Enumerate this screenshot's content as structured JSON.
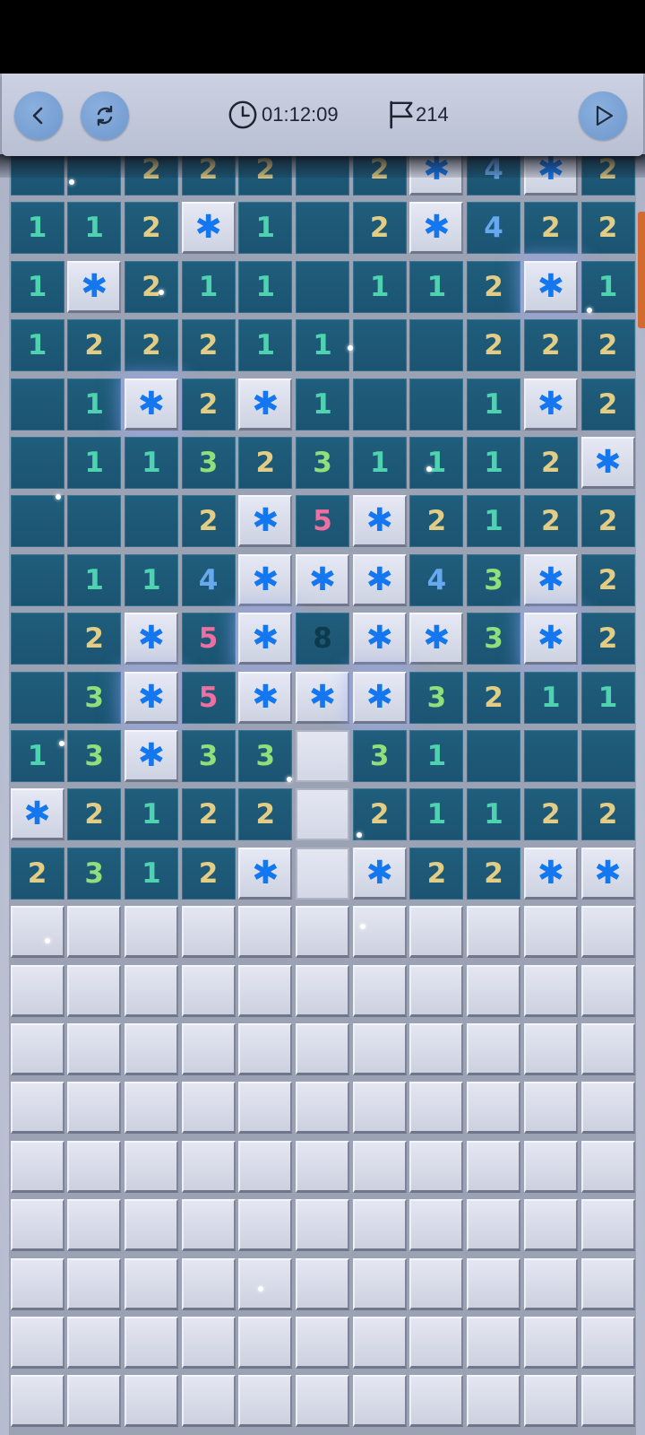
{
  "toolbar": {
    "back_icon": "chevron-left-icon",
    "restart_icon": "refresh-icon",
    "timer": "01:12:09",
    "timer_icon": "clock-icon",
    "flags_remaining": "214",
    "flags_icon": "flag-icon",
    "play_icon": "play-icon"
  },
  "colors": {
    "open_cell": "#1f5e7c",
    "covered_cell": "#dadde9",
    "mine": "#1577f0",
    "n1": "#4fd2b0",
    "n2": "#e3cd84",
    "n3": "#8fe07b",
    "n4": "#67a9ee",
    "n5": "#ee6fa0",
    "n8": "#0e3b4c",
    "side_tab": "#d36a2f"
  },
  "board": {
    "columns": 11,
    "legend": "N=number open cell, . = empty open cell, * = mine (snowflake), # = covered, o = flat blank cell",
    "mine_glyph": "✱",
    "rows": [
      [
        ".",
        ".",
        "2",
        "2",
        "2",
        ".",
        "2",
        "*",
        "4",
        "*",
        "2"
      ],
      [
        "1",
        "1",
        "2",
        "*",
        "1",
        ".",
        "2",
        "*",
        "4",
        "2",
        "2"
      ],
      [
        "1",
        "*",
        "2",
        "1",
        "1",
        ".",
        "1",
        "1",
        "2",
        "*",
        "1"
      ],
      [
        "1",
        "2",
        "2",
        "2",
        "1",
        "1",
        ".",
        ".",
        "2",
        "2",
        "2"
      ],
      [
        ".",
        "1",
        "*",
        "2",
        "*",
        "1",
        ".",
        ".",
        "1",
        "*",
        "2"
      ],
      [
        ".",
        "1",
        "1",
        "3",
        "2",
        "3",
        "1",
        "1",
        "1",
        "2",
        "*"
      ],
      [
        ".",
        ".",
        ".",
        "2",
        "*",
        "5",
        "*",
        "2",
        "1",
        "2",
        "2"
      ],
      [
        ".",
        "1",
        "1",
        "4",
        "*",
        "*",
        "*",
        "4",
        "3",
        "*",
        "2"
      ],
      [
        ".",
        "2",
        "*",
        "5",
        "*",
        "8",
        "*",
        "*",
        "3",
        "*",
        "2"
      ],
      [
        ".",
        "3",
        "*",
        "5",
        "*",
        "*",
        "*",
        "3",
        "2",
        "1",
        "1"
      ],
      [
        "1",
        "3",
        "*",
        "3",
        "3",
        "o",
        "3",
        "1",
        ".",
        ".",
        "."
      ],
      [
        "*",
        "2",
        "1",
        "2",
        "2",
        "o",
        "2",
        "1",
        "1",
        "2",
        "2"
      ],
      [
        "2",
        "3",
        "1",
        "2",
        "*",
        "o",
        "*",
        "2",
        "2",
        "*",
        "*"
      ],
      [
        "#",
        "#",
        "#",
        "#",
        "#",
        "#",
        "#",
        "#",
        "#",
        "#",
        "#"
      ],
      [
        "#",
        "#",
        "#",
        "#",
        "#",
        "#",
        "#",
        "#",
        "#",
        "#",
        "#"
      ],
      [
        "#",
        "#",
        "#",
        "#",
        "#",
        "#",
        "#",
        "#",
        "#",
        "#",
        "#"
      ],
      [
        "#",
        "#",
        "#",
        "#",
        "#",
        "#",
        "#",
        "#",
        "#",
        "#",
        "#"
      ],
      [
        "#",
        "#",
        "#",
        "#",
        "#",
        "#",
        "#",
        "#",
        "#",
        "#",
        "#"
      ],
      [
        "#",
        "#",
        "#",
        "#",
        "#",
        "#",
        "#",
        "#",
        "#",
        "#",
        "#"
      ],
      [
        "#",
        "#",
        "#",
        "#",
        "#",
        "#",
        "#",
        "#",
        "#",
        "#",
        "#"
      ],
      [
        "#",
        "#",
        "#",
        "#",
        "#",
        "#",
        "#",
        "#",
        "#",
        "#",
        "#"
      ],
      [
        "#",
        "#",
        "#",
        "#",
        "#",
        "#",
        "#",
        "#",
        "#",
        "#",
        "#"
      ]
    ]
  }
}
